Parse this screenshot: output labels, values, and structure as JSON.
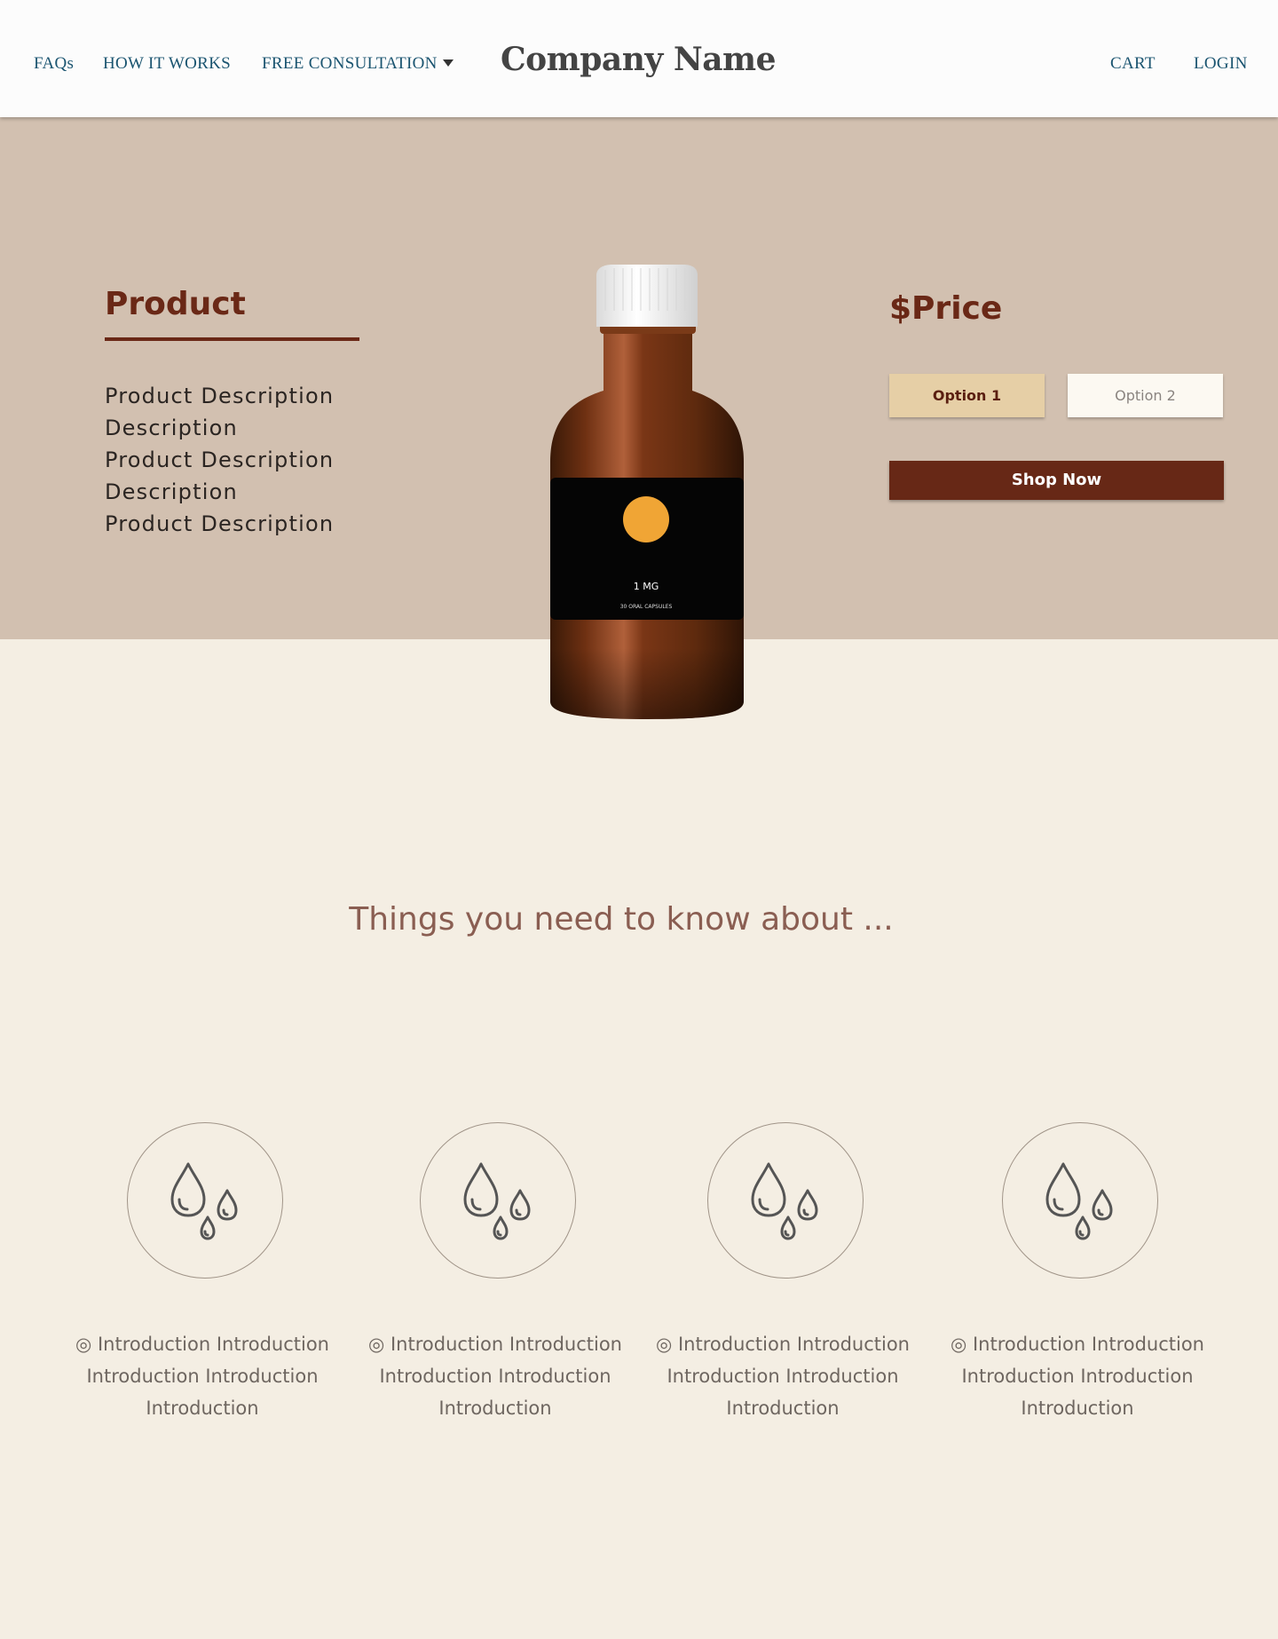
{
  "nav": {
    "faqs": "FAQs",
    "how_it_works": "HOW IT WORKS",
    "free_consultation": "FREE CONSULTATION",
    "brand": "Company Name",
    "cart": "CART",
    "login": "LOGIN"
  },
  "hero": {
    "title": "Product",
    "description_lines": [
      "Product Description",
      "Description",
      "Product Description",
      "Description",
      "Product Description"
    ],
    "price": "$Price",
    "option1": "Option 1",
    "option2": "Option 2",
    "shop_now": "Shop Now",
    "bottle_label": {
      "dose": "1 MG",
      "sub": "30 ORAL CAPSULES"
    }
  },
  "section": {
    "heading": "Things you need to know about ...",
    "features": [
      {
        "icon": "droplets-icon",
        "text": "◎ Introduction Introduction Introduction Introduction Introduction"
      },
      {
        "icon": "droplets-icon",
        "text": "◎ Introduction Introduction Introduction Introduction Introduction"
      },
      {
        "icon": "droplets-icon",
        "text": "◎ Introduction Introduction Introduction Introduction Introduction"
      },
      {
        "icon": "droplets-icon",
        "text": "◎ Introduction Introduction Introduction Introduction Introduction"
      }
    ]
  },
  "colors": {
    "accent": "#672816",
    "hero_bg": "#d2c0b0",
    "page_bg": "#f4eee3",
    "nav_link": "#1a5470",
    "option_selected": "#e6cfa6"
  }
}
